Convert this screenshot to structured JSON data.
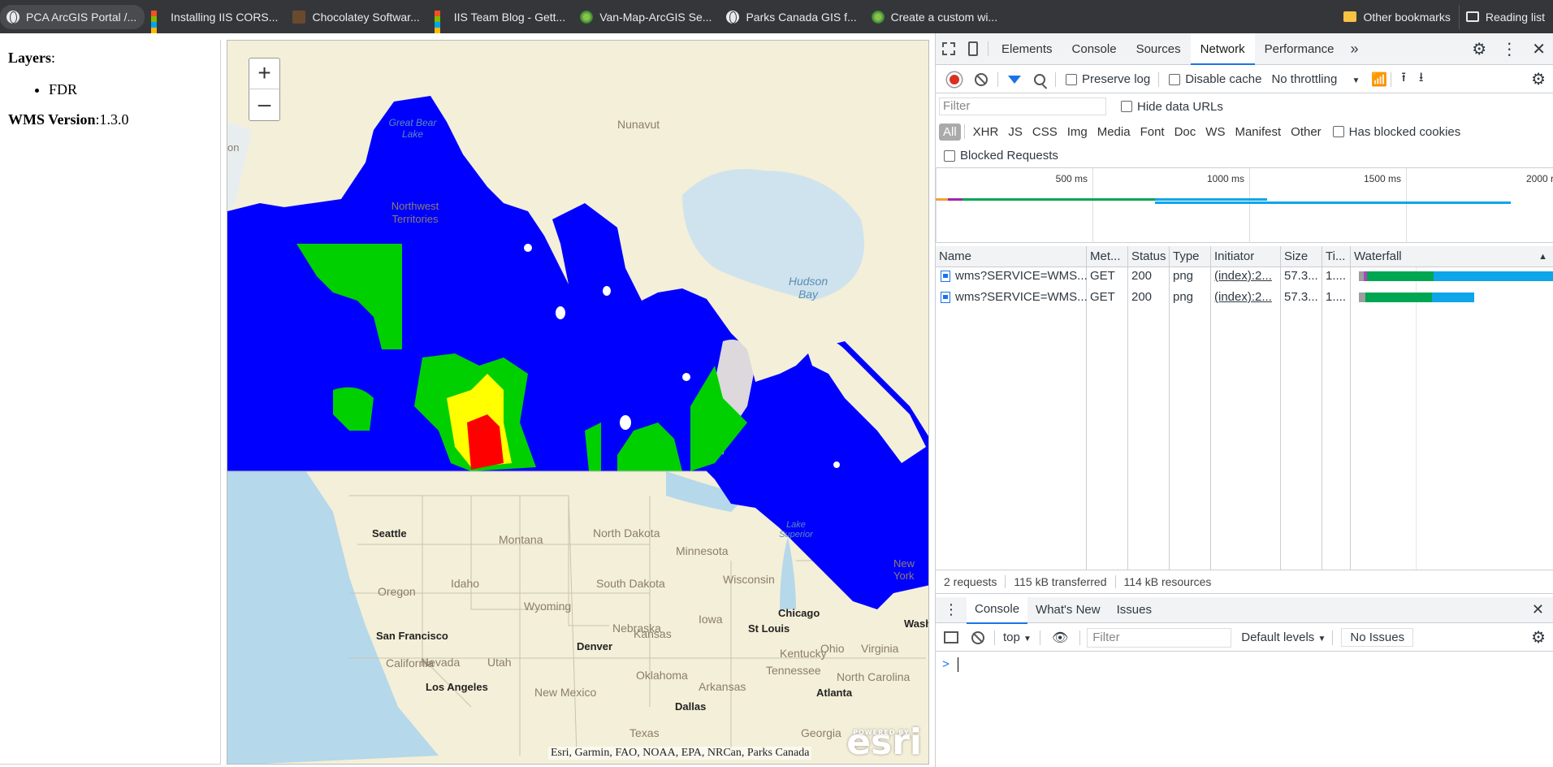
{
  "bookmarks": [
    {
      "label": "PCA ArcGIS Portal /...",
      "icon": "globe-icon"
    },
    {
      "label": "Installing IIS CORS...",
      "icon": "microsoft-icon"
    },
    {
      "label": "Chocolatey Softwar...",
      "icon": "chocolatey-icon"
    },
    {
      "label": "IIS Team Blog - Gett...",
      "icon": "microsoft-icon"
    },
    {
      "label": "Van-Map-ArcGIS Se...",
      "icon": "arcgis-icon"
    },
    {
      "label": "Parks Canada GIS f...",
      "icon": "globe-icon"
    },
    {
      "label": "Create a custom wi...",
      "icon": "arcgis-icon"
    }
  ],
  "bookmarks_right": {
    "other": "Other bookmarks",
    "reading": "Reading list"
  },
  "info": {
    "layers_label": "Layers",
    "layers": [
      "FDR"
    ],
    "wms_label": "WMS Version",
    "wms_version": "1.3.0"
  },
  "map": {
    "zoom_in": "+",
    "zoom_out": "–",
    "attribution": "Esri, Garmin, FAO, NOAA, EPA, NRCan, Parks Canada",
    "logo_top": "POWERED BY",
    "logo": "esri",
    "places": [
      "Nunavut",
      "Great Bear Lake",
      "Northwest Territories",
      "Hudson Bay",
      "Seattle",
      "Montana",
      "North Dakota",
      "Minnesota",
      "Lake Superior",
      "Oregon",
      "Idaho",
      "South Dakota",
      "Wisconsin",
      "Wyoming",
      "Chicago",
      "Iowa",
      "Nebraska",
      "Denver",
      "Ohio",
      "Nevada",
      "Utah",
      "San Francisco",
      "Kansas",
      "St Louis",
      "Kentucky",
      "Virginia",
      "California",
      "Oklahoma",
      "Tennessee",
      "Los Angeles",
      "New Mexico",
      "Arkansas",
      "Atlanta",
      "North Carolina",
      "Dallas",
      "Texas",
      "Georgia",
      "Wash",
      "New York",
      "on"
    ],
    "colors": {
      "blue": "#0000ff",
      "green": "#00d000",
      "yellow": "#ffff00",
      "red": "#ff0000",
      "land": "#f4efd8",
      "water": "#b5d8ea"
    }
  },
  "devtools": {
    "tabs": [
      "Elements",
      "Console",
      "Sources",
      "Network",
      "Performance"
    ],
    "active_tab": "Network",
    "toolbar": {
      "preserve_log": "Preserve log",
      "disable_cache": "Disable cache",
      "throttling": "No throttling"
    },
    "filter_placeholder": "Filter",
    "hide_data_urls": "Hide data URLs",
    "types": [
      "All",
      "XHR",
      "JS",
      "CSS",
      "Img",
      "Media",
      "Font",
      "Doc",
      "WS",
      "Manifest",
      "Other"
    ],
    "has_blocked_cookies": "Has blocked cookies",
    "blocked_requests": "Blocked Requests",
    "timeline_ticks": [
      "500 ms",
      "1000 ms",
      "1500 ms",
      "2000 r"
    ],
    "columns": [
      "Name",
      "Met...",
      "Status",
      "Type",
      "Initiator",
      "Size",
      "Ti...",
      "Waterfall"
    ],
    "rows": [
      {
        "name": "wms?SERVICE=WMS...",
        "method": "GET",
        "status": "200",
        "type": "png",
        "initiator": "(index):2...",
        "size": "57.3...",
        "time": "1...."
      },
      {
        "name": "wms?SERVICE=WMS...",
        "method": "GET",
        "status": "200",
        "type": "png",
        "initiator": "(index):2...",
        "size": "57.3...",
        "time": "1...."
      }
    ],
    "summary": {
      "requests": "2 requests",
      "transferred": "115 kB transferred",
      "resources": "114 kB resources"
    },
    "drawer_tabs": [
      "Console",
      "What's New",
      "Issues"
    ],
    "console": {
      "context": "top",
      "filter_placeholder": "Filter",
      "levels": "Default levels",
      "issues": "No Issues",
      "prompt": ">"
    }
  }
}
